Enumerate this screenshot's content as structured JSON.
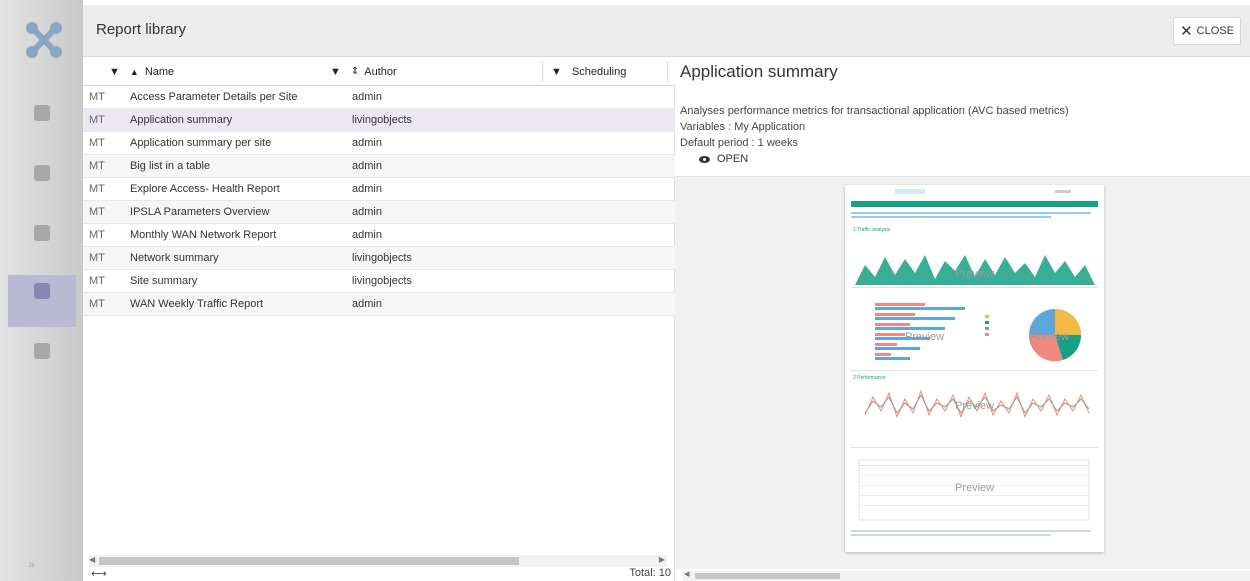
{
  "modal": {
    "title": "Report library",
    "close_label": "CLOSE"
  },
  "table": {
    "columns": {
      "name": "Name",
      "author": "Author",
      "scheduling": "Scheduling"
    },
    "rows": [
      {
        "type": "MT",
        "name": "Access Parameter Details per Site",
        "author": "admin"
      },
      {
        "type": "MT",
        "name": "Application summary",
        "author": "livingobjects"
      },
      {
        "type": "MT",
        "name": "Application summary per site",
        "author": "admin"
      },
      {
        "type": "MT",
        "name": "Big list in a table",
        "author": "admin"
      },
      {
        "type": "MT",
        "name": "Explore Access- Health Report",
        "author": "admin"
      },
      {
        "type": "MT",
        "name": "IPSLA Parameters Overview",
        "author": "admin"
      },
      {
        "type": "MT",
        "name": "Monthly WAN Network Report",
        "author": "admin"
      },
      {
        "type": "MT",
        "name": "Network summary",
        "author": "livingobjects"
      },
      {
        "type": "MT",
        "name": "Site summary",
        "author": "livingobjects"
      },
      {
        "type": "MT",
        "name": "WAN Weekly Traffic Report",
        "author": "admin"
      }
    ],
    "selected_index": 1,
    "total_label": "Total: 10"
  },
  "detail": {
    "title": "Application summary",
    "description": "Analyses performance metrics for transactional application (AVC based metrics)",
    "variables": "Variables : My Application",
    "period": "Default period : 1 weeks",
    "open_label": "OPEN"
  },
  "preview": {
    "section1": "1 Traffic analysis",
    "section2": "2 Performance",
    "watermark": "Preview"
  },
  "colors": {
    "accent": "#16a085",
    "selected_row": "#ece7f4"
  },
  "icons": {
    "logo": "x-logo-icon",
    "close": "close-icon",
    "filter": "filter-icon",
    "sort_asc": "sort-asc-icon",
    "sort": "sort-icon",
    "eye": "eye-icon",
    "resize": "resize-horizontal-icon"
  }
}
